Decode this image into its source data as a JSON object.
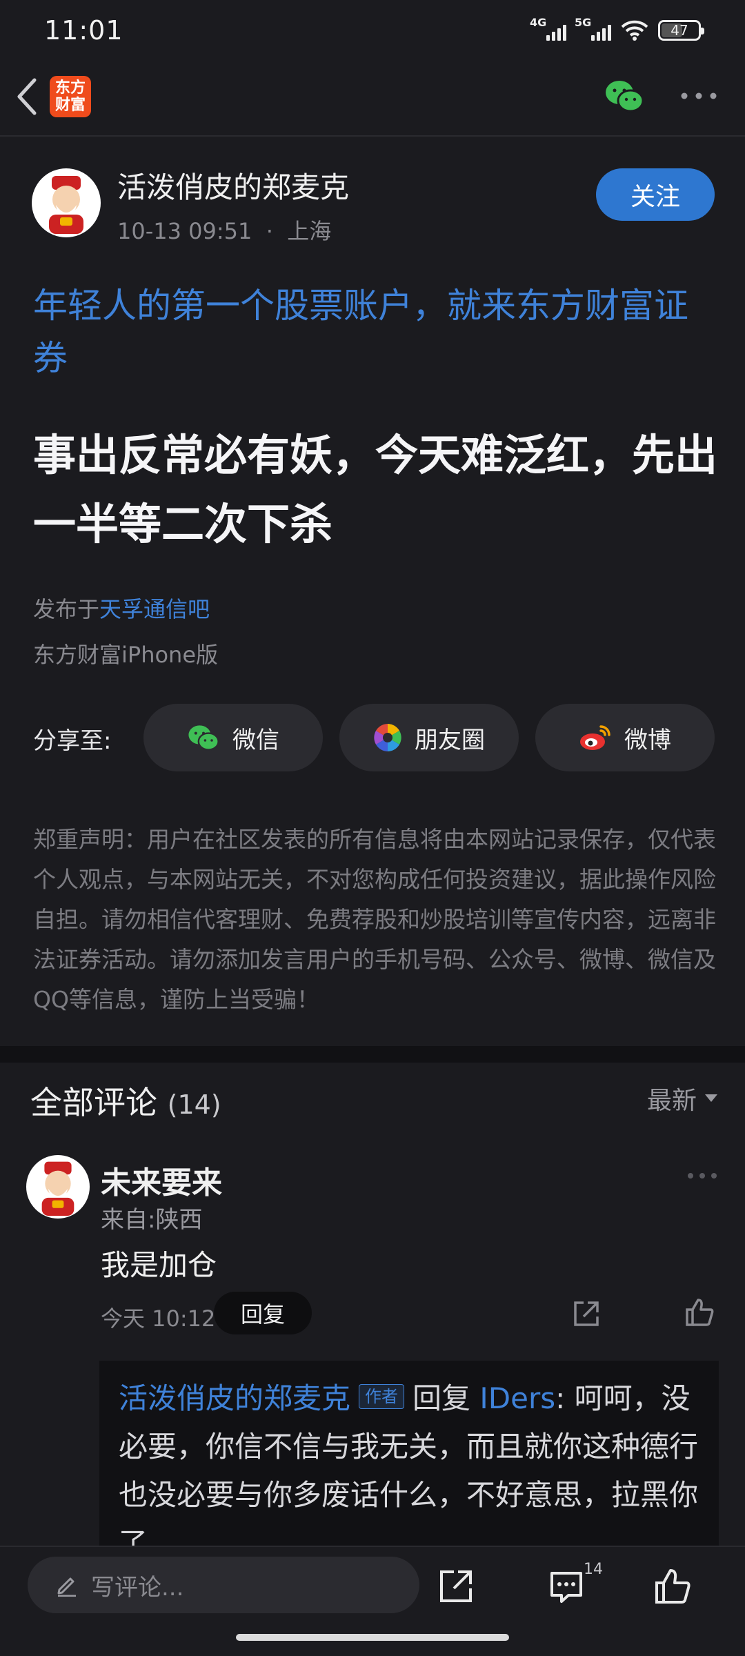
{
  "status_bar": {
    "time": "11:01",
    "network_1": "4G",
    "network_2": "5G",
    "battery": "47"
  },
  "header": {
    "logo_text_top": "东方",
    "logo_text_bottom": "财富"
  },
  "post": {
    "author_name": "活泼俏皮的郑麦克",
    "date": "10-13 09:51",
    "dot": "·",
    "location": "上海",
    "follow_label": "关注",
    "promo_text": "年轻人的第一个股票账户，就来东方财富证券",
    "title": "事出反常必有妖，今天难泛红，先出一半等二次下杀",
    "published_prefix": "发布于",
    "published_forum": "天孚通信吧",
    "client": "东方财富iPhone版"
  },
  "share": {
    "label": "分享至:",
    "wechat": "微信",
    "moments": "朋友圈",
    "weibo": "微博"
  },
  "disclaimer": "郑重声明：用户在社区发表的所有信息将由本网站记录保存，仅代表个人观点，与本网站无关，不对您构成任何投资建议，据此操作风险自担。请勿相信代客理财、免费荐股和炒股培训等宣传内容，远离非法证券活动。请勿添加发言用户的手机号码、公众号、微博、微信及QQ等信息，谨防上当受骗！",
  "comments": {
    "title": "全部评论",
    "count": "(14)",
    "sort_label": "最新",
    "items": [
      {
        "name": "未来要来",
        "location": "来自:陕西",
        "text": "我是加仓",
        "time": "今天 10:12",
        "reply_label": "回复",
        "reply": {
          "author": "活泼俏皮的郑麦克",
          "tag": "作者",
          "verb": "回复",
          "target": "IDers",
          "text": ": 呵呵，没必要，你信不信与我无关，而且就你这种德行也没必要与你多废话什么，不好意思，拉黑你了。"
        }
      }
    ]
  },
  "bottom_bar": {
    "input_placeholder": "写评论...",
    "comment_count": "14"
  },
  "colors": {
    "background": "#1b1b1f",
    "accent_blue": "#3f82d9",
    "follow_button": "#2e77d0",
    "logo": "#ef4b1c",
    "wechat_green": "#3fbf55"
  }
}
